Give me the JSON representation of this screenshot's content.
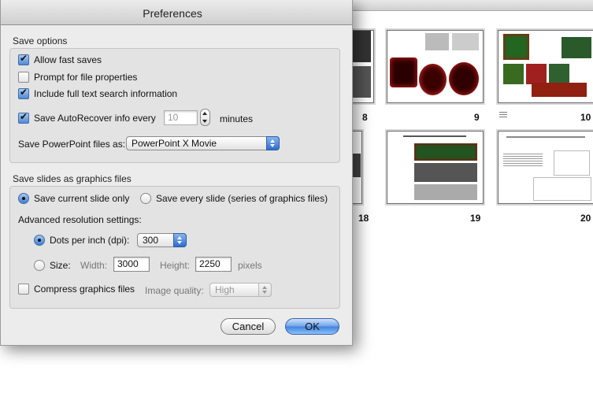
{
  "dialog": {
    "title": "Preferences",
    "save_options": {
      "label": "Save options",
      "allow_fast_saves": "Allow fast saves",
      "prompt_file_properties": "Prompt for file properties",
      "include_search_info": "Include full text search information",
      "autorecover_label": "Save AutoRecover info every",
      "autorecover_value": "10",
      "autorecover_unit": "minutes",
      "save_as_label": "Save PowerPoint files as:",
      "save_as_value": "PowerPoint X Movie"
    },
    "graphics": {
      "label": "Save slides as graphics files",
      "current_only": "Save current slide only",
      "every_slide": "Save every slide (series of graphics files)",
      "advanced_label": "Advanced resolution settings:",
      "dpi_label": "Dots per inch (dpi):",
      "dpi_value": "300",
      "size_label": "Size:",
      "width_label": "Width:",
      "width_value": "3000",
      "height_label": "Height:",
      "height_value": "2250",
      "pixels_label": "pixels",
      "compress_label": "Compress graphics files",
      "quality_label": "Image quality:",
      "quality_value": "High"
    },
    "buttons": {
      "cancel": "Cancel",
      "ok": "OK"
    }
  },
  "sorter": {
    "slide_numbers": [
      "8",
      "9",
      "10",
      "18",
      "19",
      "20"
    ]
  }
}
